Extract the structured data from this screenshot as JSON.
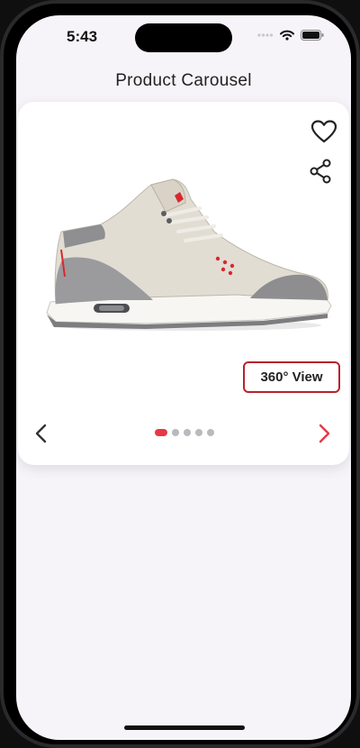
{
  "status": {
    "time": "5:43"
  },
  "header": {
    "title": "Product Carousel"
  },
  "carousel": {
    "view_label": "360° View",
    "page_count": 5,
    "active_index": 0,
    "image": "sneaker-product-image"
  },
  "icons": {
    "favorite": "heart-icon",
    "share": "share-icon",
    "prev": "chevron-left-icon",
    "next": "chevron-right-icon"
  },
  "colors": {
    "accent": "#e53945",
    "accent_border": "#b8222c",
    "background": "#f6f4f8",
    "dot_inactive": "#b9b9be"
  }
}
